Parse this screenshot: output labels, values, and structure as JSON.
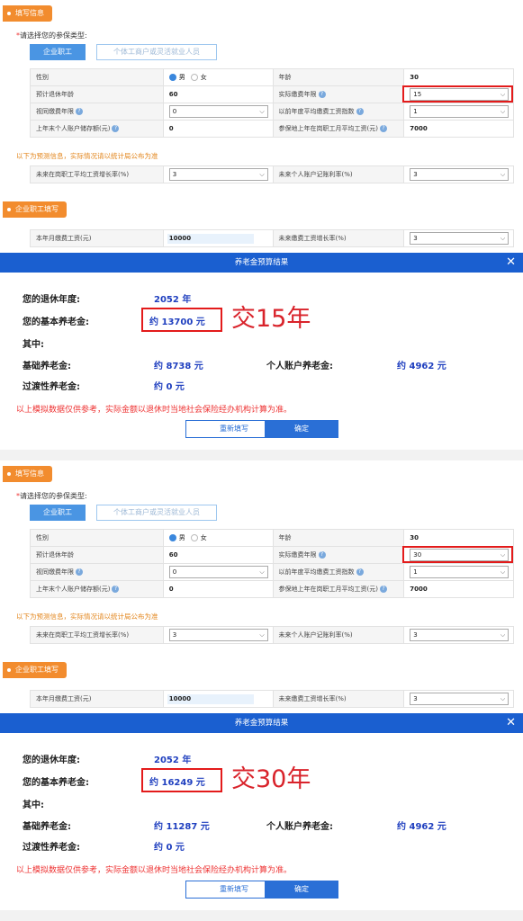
{
  "section_fill": "填写信息",
  "choose_label": "请选择您的参保类型:",
  "required_mark": "*",
  "type_tabs": [
    "企业职工",
    "个体工商户或灵活就业人员"
  ],
  "form_labels": {
    "gender": "性别",
    "age": "年龄",
    "expected_retire_age": "预计退休年龄",
    "actual_years": "实际缴费年限",
    "deemed_years": "视同缴费年限",
    "avg_index": "以前年度平均缴费工资指数",
    "last_year_balance": "上年末个人账户储存额(元)",
    "avg_wage": "参保地上年在岗职工月平均工资(元)",
    "predict_note": "以下为预测信息，实际情况请以统计局公布为准",
    "future_wage_growth": "未来在岗职工平均工资增长率(%)",
    "future_rate": "未来个人账户记账利率(%)",
    "section_employee": "企业职工填写",
    "monthly_wage": "本年月缴费工资(元)",
    "future_pay_growth": "未来缴费工资增长率(%)"
  },
  "gender_options": [
    "男",
    "女"
  ],
  "result_labels": {
    "title": "养老金预算结果",
    "close": "✕",
    "retire_year": "您的退休年度:",
    "basic_pension": "您的基本养老金:",
    "among": "其中:",
    "basic": "基础养老金:",
    "personal": "个人账户养老金:",
    "transitional": "过渡性养老金:",
    "disclaimer": "以上模拟数据仅供参考，实际金额以退休时当地社会保险经办机构计算为准。",
    "refill": "重新填写",
    "confirm": "确定"
  },
  "scenarios": [
    {
      "age": "30",
      "expected_retire_age": "60",
      "actual_years": "15",
      "deemed_years": "0",
      "avg_index": "1",
      "last_year_balance": "0",
      "avg_wage": "7000",
      "future_wage_growth": "3",
      "future_rate": "3",
      "monthly_wage": "10000",
      "future_pay_growth": "3",
      "retire_year": "2052 年",
      "basic_pension": "约 13700 元",
      "basic": "约 8738 元",
      "personal": "约 4962 元",
      "transitional": "约 0 元",
      "annotation": "交15年"
    },
    {
      "age": "30",
      "expected_retire_age": "60",
      "actual_years": "30",
      "deemed_years": "0",
      "avg_index": "1",
      "last_year_balance": "0",
      "avg_wage": "7000",
      "future_wage_growth": "3",
      "future_rate": "3",
      "monthly_wage": "10000",
      "future_pay_growth": "3",
      "retire_year": "2052 年",
      "basic_pension": "约 16249 元",
      "basic": "约 11287 元",
      "personal": "约 4962 元",
      "transitional": "约 0 元",
      "annotation": "交30年"
    }
  ],
  "colors": {
    "accent_orange": "#f28c2e",
    "header_blue": "#1a5fd0",
    "highlight_red": "#e31b1b",
    "value_blue": "#1f3fbf"
  }
}
